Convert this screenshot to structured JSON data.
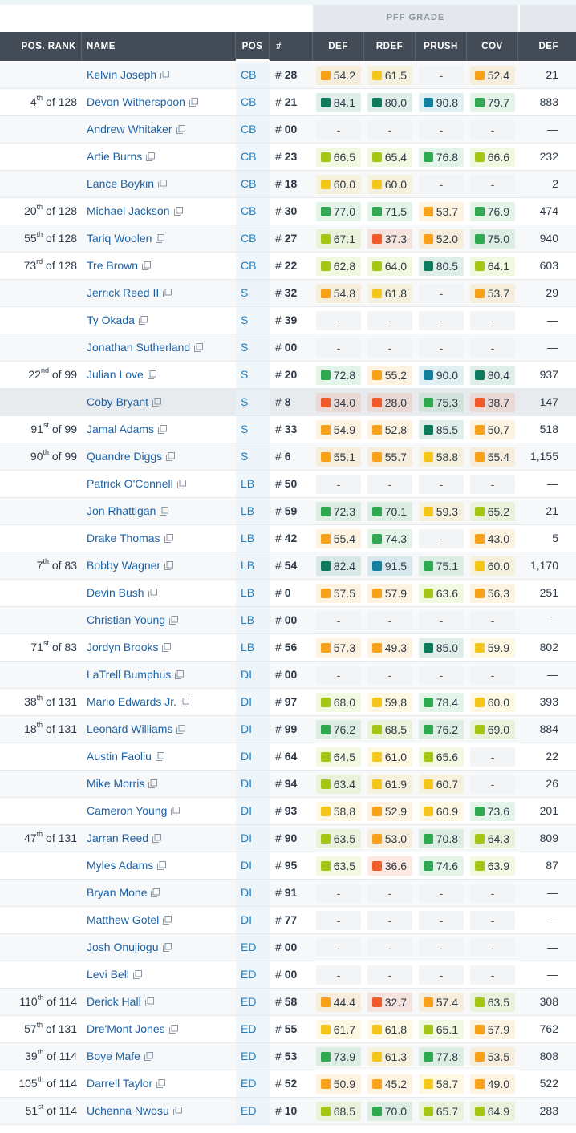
{
  "colors": {
    "header_bg": "#434b56",
    "link": "#1d62a6",
    "pos": "#1d7fc4",
    "grade_elite": "#0e7b5f",
    "grade_high": "#2fa84f",
    "grade_good": "#a4c617",
    "grade_avg": "#f4c51a",
    "grade_below": "#f8a21b",
    "grade_poor": "#f05a28",
    "grade_top": "#12809c"
  },
  "group_header": {
    "pff_grade": "PFF GRADE"
  },
  "columns": {
    "pos_rank": "POS. RANK",
    "name": "NAME",
    "pos": "POS",
    "number": "#",
    "def": "DEF",
    "rdef": "RDEF",
    "prush": "PRUSH",
    "cov": "COV",
    "snaps": "DEF"
  },
  "players": [
    {
      "rank": "",
      "of": "",
      "name": "Kelvin Joseph",
      "pos": "CB",
      "num": "28",
      "def": "54.2",
      "rdef": "61.5",
      "prush": "-",
      "cov": "52.4",
      "snaps": "21"
    },
    {
      "rank": "4th",
      "of": "128",
      "name": "Devon Witherspoon",
      "pos": "CB",
      "num": "21",
      "def": "84.1",
      "rdef": "80.0",
      "prush": "90.8",
      "cov": "79.7",
      "snaps": "883"
    },
    {
      "rank": "",
      "of": "",
      "name": "Andrew Whitaker",
      "pos": "CB",
      "num": "00",
      "def": "-",
      "rdef": "-",
      "prush": "-",
      "cov": "-",
      "snaps": "—"
    },
    {
      "rank": "",
      "of": "",
      "name": "Artie Burns",
      "pos": "CB",
      "num": "23",
      "def": "66.5",
      "rdef": "65.4",
      "prush": "76.8",
      "cov": "66.6",
      "snaps": "232"
    },
    {
      "rank": "",
      "of": "",
      "name": "Lance Boykin",
      "pos": "CB",
      "num": "18",
      "def": "60.0",
      "rdef": "60.0",
      "prush": "-",
      "cov": "-",
      "snaps": "2"
    },
    {
      "rank": "20th",
      "of": "128",
      "name": "Michael Jackson",
      "pos": "CB",
      "num": "30",
      "def": "77.0",
      "rdef": "71.5",
      "prush": "53.7",
      "cov": "76.9",
      "snaps": "474"
    },
    {
      "rank": "55th",
      "of": "128",
      "name": "Tariq Woolen",
      "pos": "CB",
      "num": "27",
      "def": "67.1",
      "rdef": "37.3",
      "prush": "52.0",
      "cov": "75.0",
      "snaps": "940"
    },
    {
      "rank": "73rd",
      "of": "128",
      "name": "Tre Brown",
      "pos": "CB",
      "num": "22",
      "def": "62.8",
      "rdef": "64.0",
      "prush": "80.5",
      "cov": "64.1",
      "snaps": "603"
    },
    {
      "rank": "",
      "of": "",
      "name": "Jerrick Reed II",
      "pos": "S",
      "num": "32",
      "def": "54.8",
      "rdef": "61.8",
      "prush": "-",
      "cov": "53.7",
      "snaps": "29"
    },
    {
      "rank": "",
      "of": "",
      "name": "Ty Okada",
      "pos": "S",
      "num": "39",
      "def": "-",
      "rdef": "-",
      "prush": "-",
      "cov": "-",
      "snaps": "—"
    },
    {
      "rank": "",
      "of": "",
      "name": "Jonathan Sutherland",
      "pos": "S",
      "num": "00",
      "def": "-",
      "rdef": "-",
      "prush": "-",
      "cov": "-",
      "snaps": "—"
    },
    {
      "rank": "22nd",
      "of": "99",
      "name": "Julian Love",
      "pos": "S",
      "num": "20",
      "def": "72.8",
      "rdef": "55.2",
      "prush": "90.0",
      "cov": "80.4",
      "snaps": "937"
    },
    {
      "rank": "",
      "of": "",
      "name": "Coby Bryant",
      "pos": "S",
      "num": "8",
      "def": "34.0",
      "rdef": "28.0",
      "prush": "75.3",
      "cov": "38.7",
      "snaps": "147",
      "highlight": true
    },
    {
      "rank": "91st",
      "of": "99",
      "name": "Jamal Adams",
      "pos": "S",
      "num": "33",
      "def": "54.9",
      "rdef": "52.8",
      "prush": "85.5",
      "cov": "50.7",
      "snaps": "518"
    },
    {
      "rank": "90th",
      "of": "99",
      "name": "Quandre Diggs",
      "pos": "S",
      "num": "6",
      "def": "55.1",
      "rdef": "55.7",
      "prush": "58.8",
      "cov": "55.4",
      "snaps": "1,155"
    },
    {
      "rank": "",
      "of": "",
      "name": "Patrick O'Connell",
      "pos": "LB",
      "num": "50",
      "def": "-",
      "rdef": "-",
      "prush": "-",
      "cov": "-",
      "snaps": "—"
    },
    {
      "rank": "",
      "of": "",
      "name": "Jon Rhattigan",
      "pos": "LB",
      "num": "59",
      "def": "72.3",
      "rdef": "70.1",
      "prush": "59.3",
      "cov": "65.2",
      "snaps": "21"
    },
    {
      "rank": "",
      "of": "",
      "name": "Drake Thomas",
      "pos": "LB",
      "num": "42",
      "def": "55.4",
      "rdef": "74.3",
      "prush": "-",
      "cov": "43.0",
      "snaps": "5"
    },
    {
      "rank": "7th",
      "of": "83",
      "name": "Bobby Wagner",
      "pos": "LB",
      "num": "54",
      "def": "82.4",
      "rdef": "91.5",
      "prush": "75.1",
      "cov": "60.0",
      "snaps": "1,170"
    },
    {
      "rank": "",
      "of": "",
      "name": "Devin Bush",
      "pos": "LB",
      "num": "0",
      "def": "57.5",
      "rdef": "57.9",
      "prush": "63.6",
      "cov": "56.3",
      "snaps": "251"
    },
    {
      "rank": "",
      "of": "",
      "name": "Christian Young",
      "pos": "LB",
      "num": "00",
      "def": "-",
      "rdef": "-",
      "prush": "-",
      "cov": "-",
      "snaps": "—"
    },
    {
      "rank": "71st",
      "of": "83",
      "name": "Jordyn Brooks",
      "pos": "LB",
      "num": "56",
      "def": "57.3",
      "rdef": "49.3",
      "prush": "85.0",
      "cov": "59.9",
      "snaps": "802"
    },
    {
      "rank": "",
      "of": "",
      "name": "LaTrell Bumphus",
      "pos": "DI",
      "num": "00",
      "def": "-",
      "rdef": "-",
      "prush": "-",
      "cov": "-",
      "snaps": "—"
    },
    {
      "rank": "38th",
      "of": "131",
      "name": "Mario Edwards Jr.",
      "pos": "DI",
      "num": "97",
      "def": "68.0",
      "rdef": "59.8",
      "prush": "78.4",
      "cov": "60.0",
      "snaps": "393"
    },
    {
      "rank": "18th",
      "of": "131",
      "name": "Leonard Williams",
      "pos": "DI",
      "num": "99",
      "def": "76.2",
      "rdef": "68.5",
      "prush": "76.2",
      "cov": "69.0",
      "snaps": "884"
    },
    {
      "rank": "",
      "of": "",
      "name": "Austin Faoliu",
      "pos": "DI",
      "num": "64",
      "def": "64.5",
      "rdef": "61.0",
      "prush": "65.6",
      "cov": "-",
      "snaps": "22"
    },
    {
      "rank": "",
      "of": "",
      "name": "Mike Morris",
      "pos": "DI",
      "num": "94",
      "def": "63.4",
      "rdef": "61.9",
      "prush": "60.7",
      "cov": "-",
      "snaps": "26"
    },
    {
      "rank": "",
      "of": "",
      "name": "Cameron Young",
      "pos": "DI",
      "num": "93",
      "def": "58.8",
      "rdef": "52.9",
      "prush": "60.9",
      "cov": "73.6",
      "snaps": "201"
    },
    {
      "rank": "47th",
      "of": "131",
      "name": "Jarran Reed",
      "pos": "DI",
      "num": "90",
      "def": "63.5",
      "rdef": "53.0",
      "prush": "70.8",
      "cov": "64.3",
      "snaps": "809"
    },
    {
      "rank": "",
      "of": "",
      "name": "Myles Adams",
      "pos": "DI",
      "num": "95",
      "def": "63.5",
      "rdef": "36.6",
      "prush": "74.6",
      "cov": "63.9",
      "snaps": "87"
    },
    {
      "rank": "",
      "of": "",
      "name": "Bryan Mone",
      "pos": "DI",
      "num": "91",
      "def": "-",
      "rdef": "-",
      "prush": "-",
      "cov": "-",
      "snaps": "—"
    },
    {
      "rank": "",
      "of": "",
      "name": "Matthew Gotel",
      "pos": "DI",
      "num": "77",
      "def": "-",
      "rdef": "-",
      "prush": "-",
      "cov": "-",
      "snaps": "—"
    },
    {
      "rank": "",
      "of": "",
      "name": "Josh Onujiogu",
      "pos": "ED",
      "num": "00",
      "def": "-",
      "rdef": "-",
      "prush": "-",
      "cov": "-",
      "snaps": "—"
    },
    {
      "rank": "",
      "of": "",
      "name": "Levi Bell",
      "pos": "ED",
      "num": "00",
      "def": "-",
      "rdef": "-",
      "prush": "-",
      "cov": "-",
      "snaps": "—"
    },
    {
      "rank": "110th",
      "of": "114",
      "name": "Derick Hall",
      "pos": "ED",
      "num": "58",
      "def": "44.4",
      "rdef": "32.7",
      "prush": "57.4",
      "cov": "63.5",
      "snaps": "308"
    },
    {
      "rank": "57th",
      "of": "131",
      "name": "Dre'Mont Jones",
      "pos": "ED",
      "num": "55",
      "def": "61.7",
      "rdef": "61.8",
      "prush": "65.1",
      "cov": "57.9",
      "snaps": "762"
    },
    {
      "rank": "39th",
      "of": "114",
      "name": "Boye Mafe",
      "pos": "ED",
      "num": "53",
      "def": "73.9",
      "rdef": "61.3",
      "prush": "77.8",
      "cov": "53.5",
      "snaps": "808"
    },
    {
      "rank": "105th",
      "of": "114",
      "name": "Darrell Taylor",
      "pos": "ED",
      "num": "52",
      "def": "50.9",
      "rdef": "45.2",
      "prush": "58.7",
      "cov": "49.0",
      "snaps": "522"
    },
    {
      "rank": "51st",
      "of": "114",
      "name": "Uchenna Nwosu",
      "pos": "ED",
      "num": "10",
      "def": "68.5",
      "rdef": "70.0",
      "prush": "65.7",
      "cov": "64.9",
      "snaps": "283"
    }
  ]
}
